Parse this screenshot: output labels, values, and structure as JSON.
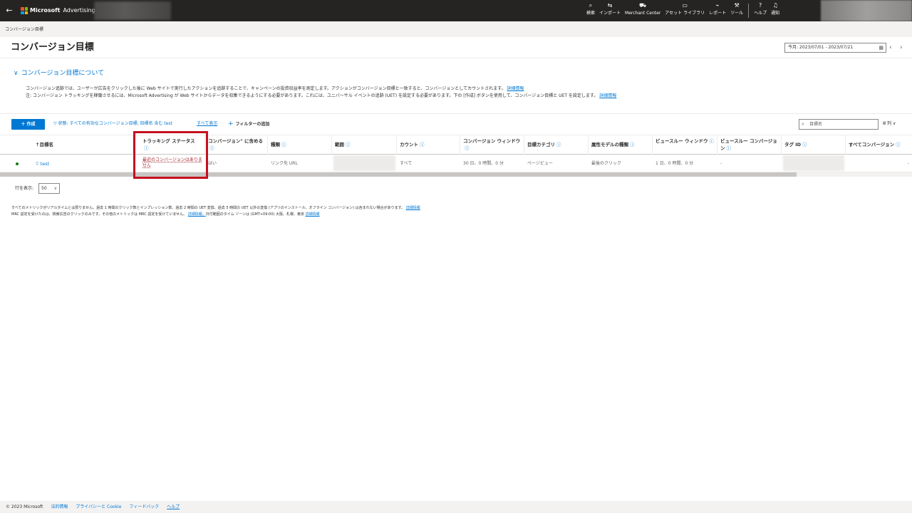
{
  "header": {
    "brand": "Microsoft",
    "product": "Advertising",
    "nav": [
      {
        "label": "検索",
        "icon": "search-icon",
        "glyph": "⌕"
      },
      {
        "label": "インポート",
        "icon": "import-icon",
        "glyph": "⇆"
      },
      {
        "label": "Merchant Center",
        "icon": "cart-icon",
        "glyph": "⛟"
      },
      {
        "label": "アセット ライブラリ",
        "icon": "image-library-icon",
        "glyph": "▭"
      },
      {
        "label": "レポート",
        "icon": "chart-icon",
        "glyph": "⌁"
      },
      {
        "label": "ツール",
        "icon": "wrench-icon",
        "glyph": "⚒"
      },
      {
        "label": "ヘルプ",
        "icon": "help-icon",
        "glyph": "?"
      },
      {
        "label": "通知",
        "icon": "bell-icon",
        "glyph": "♫"
      }
    ]
  },
  "breadcrumb": "コンバージョン目標",
  "page_title": "コンバージョン目標",
  "date_range": "今月: 2023/07/01 - 2023/07/21",
  "about": {
    "toggle_label": "コンバージョン目標について",
    "line1": "コンバージョン追跡では、ユーザーが広告をクリックした後に Web サイトで実行したアクションを追跡することで、キャンペーンの投資収益率を測定します。アクションがコンバージョン目標と一致すると、コンバージョンとしてカウントされます。",
    "line1_link": "詳細情報",
    "line2": "注: コンバージョン トラッキングを稼働させるには、Microsoft Advertising が Web サイトからデータを収集できるようにする必要があります。これには、ユニバーサル イベントの追跡 (UET) を設定する必要があります。下の [作成] ボタンを使用して、コンバージョン目標と UET を設定します。",
    "line2_link": "詳細情報"
  },
  "toolbar": {
    "create_label": "作成",
    "filter_status": "状態: すべての有効なコンバージョン目標, 目標名 含む test",
    "show_all": "すべて表示",
    "add_filter": "フィルターの追加",
    "search_placeholder": "目標名",
    "columns_label": "列"
  },
  "table": {
    "headers": [
      "↑目標名",
      "トラッキング ステータス",
      "コンバージョン\" に含める",
      "種類",
      "範囲",
      "カウント",
      "コンバージョン ウィンドウ",
      "目標カテゴリ",
      "属性モデルの種類",
      "ビュースルー ウィンドウ",
      "ビュースルー コンバージョン",
      "タグ ID",
      "すべてコンバージョン"
    ],
    "row": {
      "goal_name": "test",
      "tracking_status": "最近のコンバージョンはありません",
      "include": "はい",
      "type": "リンク先 URL",
      "count": "すべて",
      "conversion_window": "30 日、0 時間、0 分",
      "category": "ページビュー",
      "attribution": "最後のクリック",
      "viewthrough_window": "1 日、0 時間、0 分",
      "viewthrough_conv": "-",
      "all_conv": "-"
    }
  },
  "rows_per_page": {
    "label": "行を表示:",
    "value": "50"
  },
  "notes": {
    "line1": "すべてのメトリックがリアルタイムとは限りません。過去 1 時間のクリック数とインプレッション数、過去 2 時間の UET 変換、過去 5 時間の UET 以外の変換 (アプリのインストール、オフライン コンバージョン) は含まれない場合があります。",
    "line1_link": "詳細情報",
    "line2": "MRC 認定を受けたのは、検索広告のクリックのみです。その他のメトリックは MRC 認定を受けていません。",
    "line2_link1": "詳細情報。",
    "line2_mid": "日付範囲のタイム ゾーンは (GMT+09:00) 大阪、札幌、東京",
    "line2_link2": "詳細情報"
  },
  "footer": {
    "copyright": "© 2023 Microsoft",
    "links": [
      "法的情報",
      "プライバシーと Cookie",
      "フィードバック",
      "ヘルプ"
    ]
  }
}
